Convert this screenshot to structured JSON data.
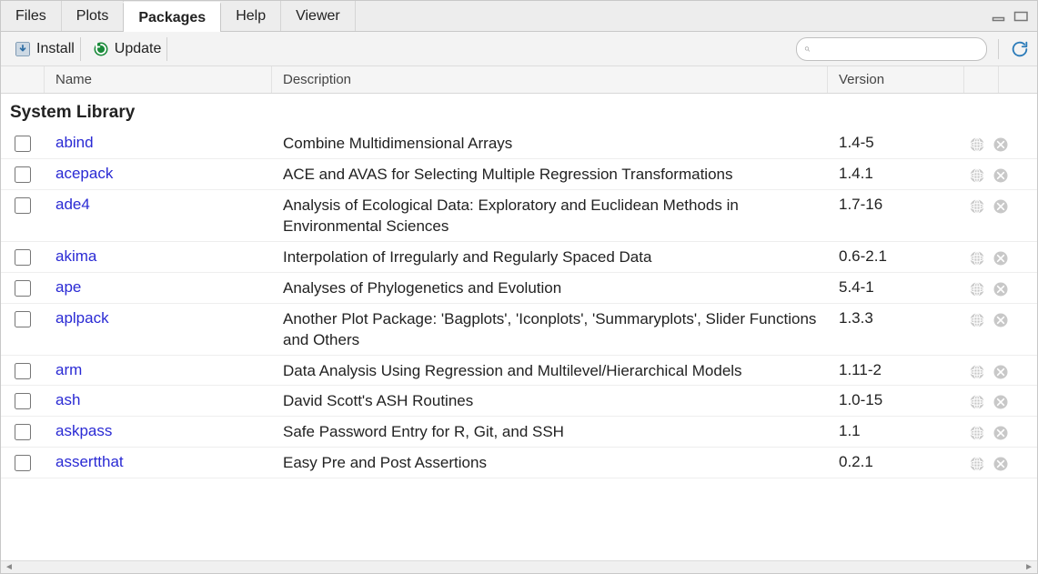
{
  "tabs": [
    "Files",
    "Plots",
    "Packages",
    "Help",
    "Viewer"
  ],
  "active_tab_index": 2,
  "toolbar": {
    "install_label": "Install",
    "update_label": "Update",
    "search_placeholder": ""
  },
  "columns": {
    "name": "Name",
    "description": "Description",
    "version": "Version"
  },
  "section_header": "System Library",
  "packages": [
    {
      "name": "abind",
      "desc": "Combine Multidimensional Arrays",
      "ver": "1.4-5"
    },
    {
      "name": "acepack",
      "desc": "ACE and AVAS for Selecting Multiple Regression Transformations",
      "ver": "1.4.1"
    },
    {
      "name": "ade4",
      "desc": "Analysis of Ecological Data: Exploratory and Euclidean Methods in Environmental Sciences",
      "ver": "1.7-16"
    },
    {
      "name": "akima",
      "desc": "Interpolation of Irregularly and Regularly Spaced Data",
      "ver": "0.6-2.1"
    },
    {
      "name": "ape",
      "desc": "Analyses of Phylogenetics and Evolution",
      "ver": "5.4-1"
    },
    {
      "name": "aplpack",
      "desc": "Another Plot Package: 'Bagplots', 'Iconplots', 'Summaryplots', Slider Functions and Others",
      "ver": "1.3.3"
    },
    {
      "name": "arm",
      "desc": "Data Analysis Using Regression and Multilevel/Hierarchical Models",
      "ver": "1.11-2"
    },
    {
      "name": "ash",
      "desc": "David Scott's ASH Routines",
      "ver": "1.0-15"
    },
    {
      "name": "askpass",
      "desc": "Safe Password Entry for R, Git, and SSH",
      "ver": "1.1"
    },
    {
      "name": "assertthat",
      "desc": "Easy Pre and Post Assertions",
      "ver": "0.2.1"
    }
  ]
}
